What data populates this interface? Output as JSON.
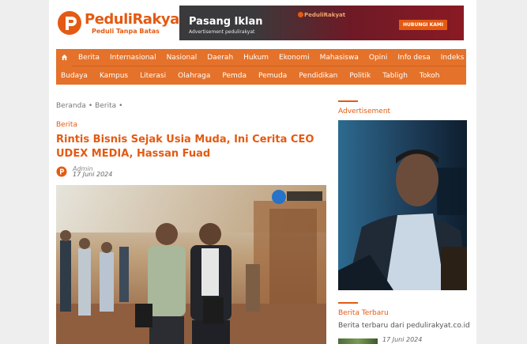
{
  "header": {
    "logo_name": "PeduliRakyat",
    "logo_tagline": "Peduli Tanpa Batas",
    "brand_color": "#e45a12"
  },
  "ad_banner": {
    "title": "Pasang Iklan",
    "subtitle": "Advertisement pedulirakyat",
    "mini_logo": "PeduliRakyat",
    "cta": "HUBUNGI KAMI"
  },
  "nav": {
    "home_icon": "home-icon",
    "row1": [
      "Berita",
      "Internasional",
      "Nasional",
      "Daerah",
      "Hukum",
      "Ekonomi",
      "Mahasiswa",
      "Opini",
      "Info desa",
      "Indeks"
    ],
    "row2": [
      "Budaya",
      "Kampus",
      "Literasi",
      "Olahraga",
      "Pemda",
      "Pemuda",
      "Pendidikan",
      "Politik",
      "Tabligh",
      "Tokoh"
    ],
    "background": "#e4722a"
  },
  "breadcrumb": {
    "home": "Beranda",
    "section": "Berita",
    "separator": "•"
  },
  "article": {
    "category": "Berita",
    "title": "Rintis Bisnis Sejak Usia Muda, Ini Cerita CEO UDEX MEDIA, Hassan Fuad",
    "author": "Admin",
    "date": "17 Juni 2024"
  },
  "sidebar": {
    "ad_label": "Advertisement",
    "latest_title": "Berita Terbaru",
    "latest_desc": "Berita terbaru dari pedulirakyat.co.id",
    "latest_item_date": "17 Juni 2024"
  }
}
